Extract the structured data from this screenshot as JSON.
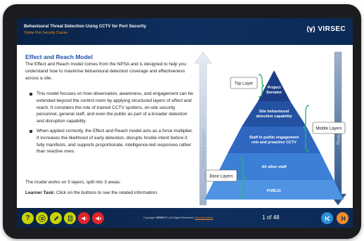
{
  "header": {
    "title": "Behavioural Threat Detection Using CCTV for Port Security",
    "subtitle": "Online Port Security Course",
    "logo_text": "VIRSEC"
  },
  "content": {
    "heading": "Effect and Reach Model",
    "intro": "The Effect and Reach model comes from the NPSA and is designed to help you understand how to maximise behavioural detection coverage and effectiveness across a site.",
    "bullets": [
      "This model focuses on how observation, awareness, and engagement can be extended beyond the control room by applying structured layers of effect and reach. It considers the role of trained CCTV spotters, on-site security personnel, general staff, and even the public as part of a broader detection and disruption capability.",
      "When applied correctly, the Effect and Reach model acts as a force multiplier. It increases the likelihood of early detection, disrupts hostile intent before it fully manifests, and supports proportionate, intelligence-led responses rather than reactive ones."
    ],
    "layers_text": "The model works on 5 layers, split into 3 areas:",
    "task_label": "Learner Task:",
    "task_text": " Click on the buttons to see the related information."
  },
  "diagram": {
    "left_arrow_label": "Effect and Impact",
    "right_arrow_label": "Reach",
    "buttons": {
      "top": "Top Layer",
      "middle": "Middle Layers",
      "base": "Base Layers"
    },
    "layers": [
      {
        "label": "Project Servator"
      },
      {
        "label": "Site behavioural detection capability"
      },
      {
        "label": "Staff in public engagement role and proactive CCTV"
      },
      {
        "label": "All other staff"
      },
      {
        "label": "PUBLIC"
      }
    ],
    "colors": [
      "#1d3e86",
      "#2452a3",
      "#2f67c1",
      "#3c7fd7",
      "#4f94e3"
    ]
  },
  "footer": {
    "copyright_prefix": "Copyright ",
    "brand": "VIRSEC",
    "copyright_suffix": "® | All Rights Reserved | ",
    "security_notice": "Security Notice",
    "pager": "1 of 48"
  },
  "toolbar_icons": [
    "help-icon",
    "menu-icon",
    "notes-icon",
    "glossary-icon",
    "audio-icon",
    "mute-icon"
  ]
}
